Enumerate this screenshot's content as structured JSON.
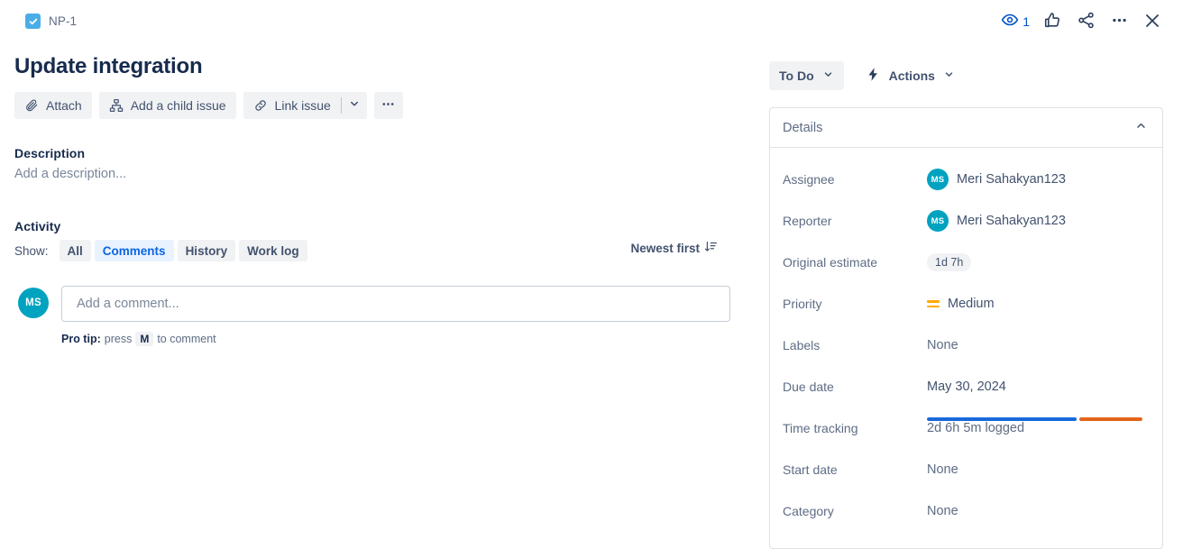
{
  "topbar": {
    "issue_key": "NP-1",
    "issue_type_icon": "task-checkbox-icon",
    "watch_icon": "eye-icon",
    "watch_count": "1",
    "like_icon": "thumbs-up-icon",
    "share_icon": "share-icon",
    "more_icon": "ellipsis-icon",
    "close_icon": "close-icon"
  },
  "issue": {
    "title": "Update integration"
  },
  "actions": {
    "attach": "Attach",
    "attach_icon": "paperclip-icon",
    "add_child": "Add a child issue",
    "add_child_icon": "child-issue-icon",
    "link_issue": "Link issue",
    "link_issue_icon": "link-icon",
    "link_chevron_icon": "chevron-down-icon",
    "more_icon": "ellipsis-icon"
  },
  "description": {
    "heading": "Description",
    "placeholder": "Add a description..."
  },
  "activity": {
    "heading": "Activity",
    "show_label": "Show:",
    "tabs": [
      {
        "label": "All",
        "selected": false
      },
      {
        "label": "Comments",
        "selected": true
      },
      {
        "label": "History",
        "selected": false
      },
      {
        "label": "Work log",
        "selected": false
      }
    ],
    "sort_label": "Newest first",
    "sort_icon": "sort-descending-icon",
    "comment_avatar_initials": "MS",
    "comment_placeholder": "Add a comment...",
    "comment_value": "",
    "pro_tip_bold": "Pro tip:",
    "pro_tip_press": "press",
    "pro_tip_key": "M",
    "pro_tip_rest": "to comment"
  },
  "sidebar": {
    "status_label": "To Do",
    "status_chevron_icon": "chevron-down-icon",
    "actions_label": "Actions",
    "actions_icon": "lightning-bolt-icon",
    "actions_chevron_icon": "chevron-down-icon",
    "details_title": "Details",
    "details_collapse_icon": "chevron-up-icon",
    "fields": {
      "assignee_label": "Assignee",
      "assignee_value": "Meri Sahakyan123",
      "assignee_initials": "MS",
      "reporter_label": "Reporter",
      "reporter_value": "Meri Sahakyan123",
      "reporter_initials": "MS",
      "original_estimate_label": "Original estimate",
      "original_estimate_value": "1d 7h",
      "priority_label": "Priority",
      "priority_value": "Medium",
      "priority_icon": "priority-medium-icon",
      "labels_label": "Labels",
      "labels_value": "None",
      "due_date_label": "Due date",
      "due_date_value": "May 30, 2024",
      "time_tracking_label": "Time tracking",
      "time_tracking_value": "2d 6h 5m logged",
      "start_date_label": "Start date",
      "start_date_value": "None",
      "category_label": "Category",
      "category_value": "None"
    }
  },
  "colors": {
    "accent_blue": "#0052CC",
    "tab_selected_bg": "#E9F2FF",
    "tab_selected_text": "#0C66E4",
    "avatar_teal": "#00A3BF",
    "priority_orange": "#FFAB00",
    "time_logged_blue": "#1868DB",
    "time_remaining_orange": "#E2641A",
    "text_dark": "#172B4D",
    "text_muted": "#5E6C84"
  }
}
